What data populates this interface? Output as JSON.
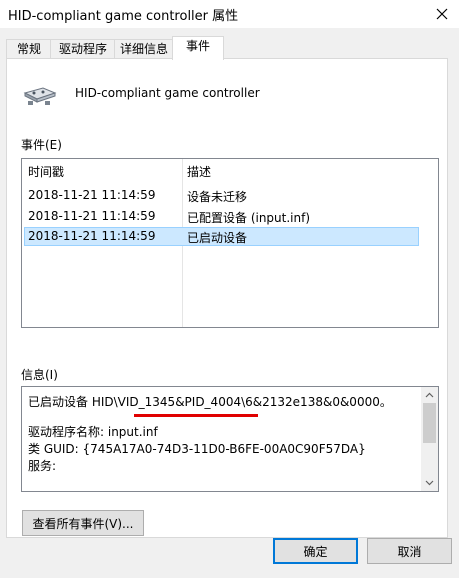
{
  "window": {
    "title": "HID-compliant game controller 属性",
    "close_icon": "close-icon"
  },
  "tabs": [
    {
      "label": "常规",
      "active": false
    },
    {
      "label": "驱动程序",
      "active": false
    },
    {
      "label": "详细信息",
      "active": false
    },
    {
      "label": "事件",
      "active": true
    }
  ],
  "device": {
    "icon": "game-controller-icon",
    "name": "HID-compliant game controller"
  },
  "events": {
    "label": "事件(E)",
    "columns": [
      "时间戳",
      "描述"
    ],
    "rows": [
      {
        "timestamp": "2018-11-21 11:14:59",
        "description": "设备未迁移",
        "selected": false
      },
      {
        "timestamp": "2018-11-21 11:14:59",
        "description": "已配置设备 (input.inf)",
        "selected": false
      },
      {
        "timestamp": "2018-11-21 11:14:59",
        "description": "已启动设备",
        "selected": true
      }
    ]
  },
  "info": {
    "label": "信息(I)",
    "lines": [
      "已启动设备 HID\\VID_1345&PID_4004\\6&2132e138&0&0000。",
      "",
      "驱动程序名称: input.inf",
      "类 GUID: {745A17A0-74D3-11D0-B6FE-00A0C90F57DA}",
      "服务:"
    ],
    "highlight_color": "#e00000"
  },
  "buttons": {
    "view_all": "查看所有事件(V)...",
    "ok": "确定",
    "cancel": "取消"
  },
  "colors": {
    "selection_bg": "#cce8ff",
    "default_button_border": "#0078d7"
  }
}
